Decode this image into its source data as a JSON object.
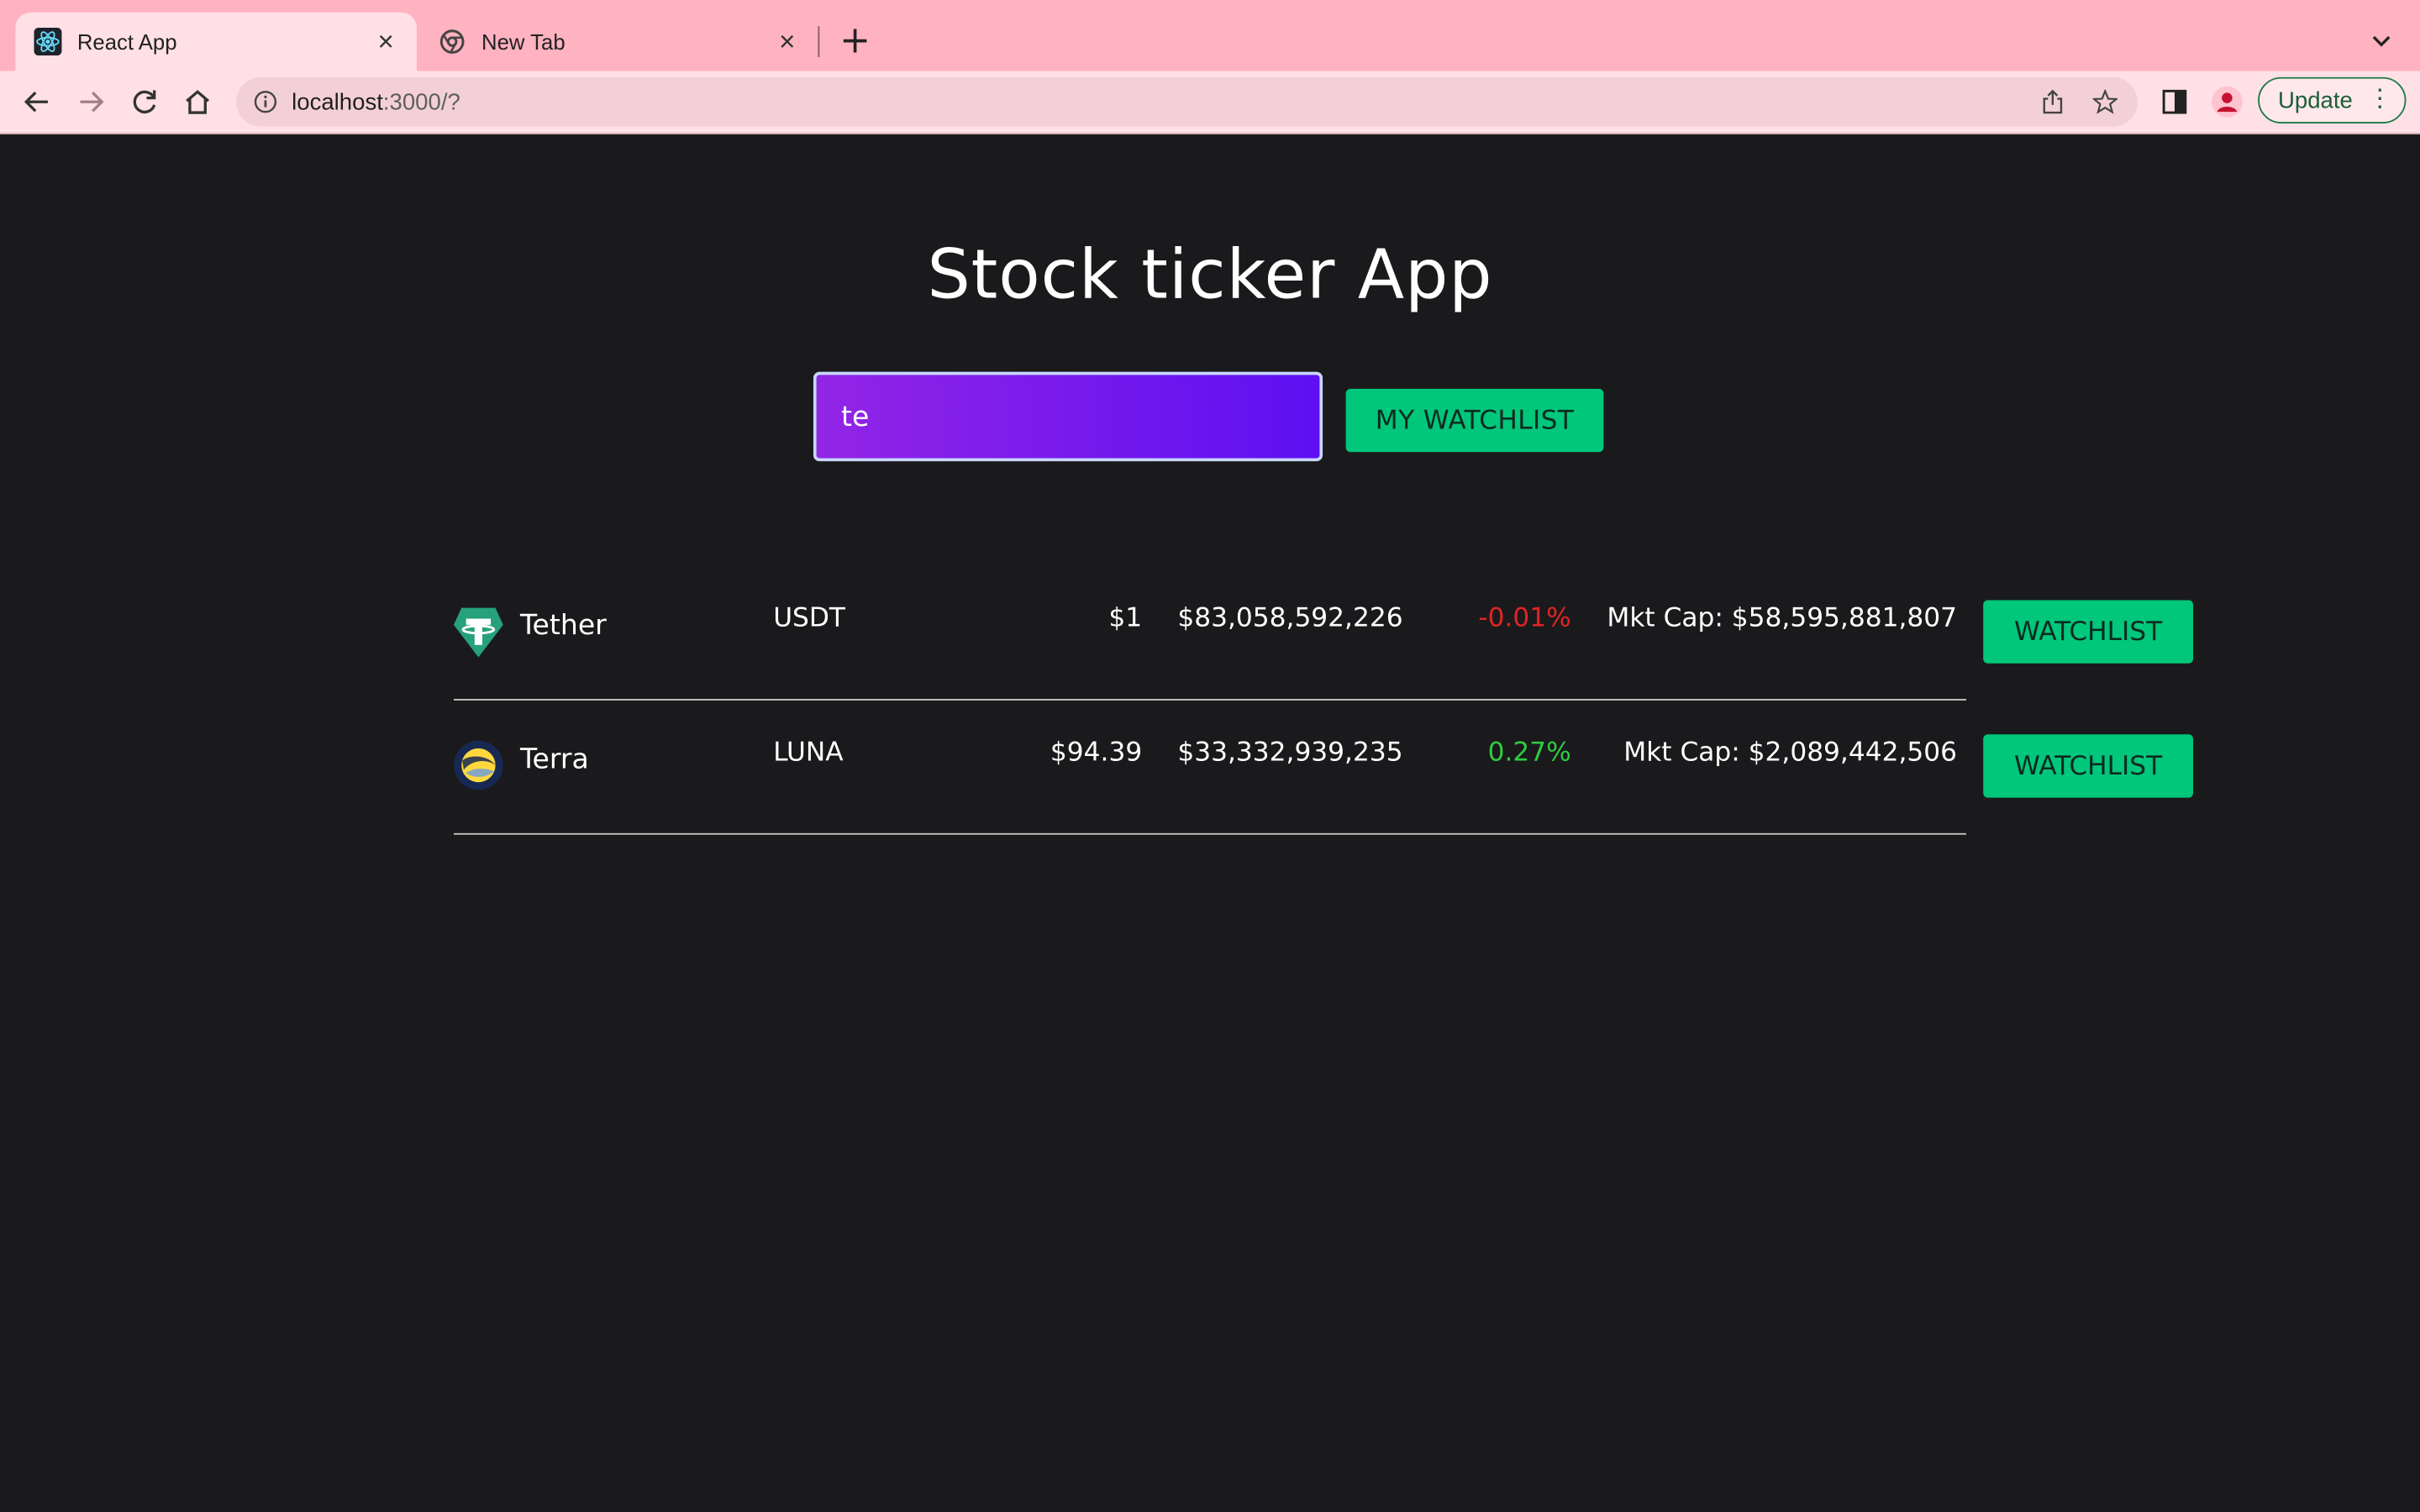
{
  "browser": {
    "tabs": [
      {
        "title": "React App",
        "icon": "react-icon",
        "active": true
      },
      {
        "title": "New Tab",
        "icon": "chrome-icon",
        "active": false
      }
    ],
    "url_host": "localhost",
    "url_rest": ":3000/?",
    "update_label": "Update"
  },
  "app": {
    "title": "Stock ticker App",
    "search_value": "te",
    "watchlist_label": "MY WATCHLIST"
  },
  "coins": [
    {
      "name": "Tether",
      "symbol": "USDT",
      "price": "$1",
      "volume": "$83,058,592,226",
      "change": "-0.01%",
      "change_color": "#e02424",
      "market_cap": "Mkt Cap: $58,595,881,807",
      "button_label": "WATCHLIST",
      "icon": "tether-icon"
    },
    {
      "name": "Terra",
      "symbol": "LUNA",
      "price": "$94.39",
      "volume": "$33,332,939,235",
      "change": "0.27%",
      "change_color": "#2ecc40",
      "market_cap": "Mkt Cap: $2,089,442,506",
      "button_label": "WATCHLIST",
      "icon": "terra-icon"
    }
  ],
  "colors": {
    "accent": "#00c77a",
    "background": "#1a1a1c",
    "tab_bar": "#ffb2c0"
  }
}
